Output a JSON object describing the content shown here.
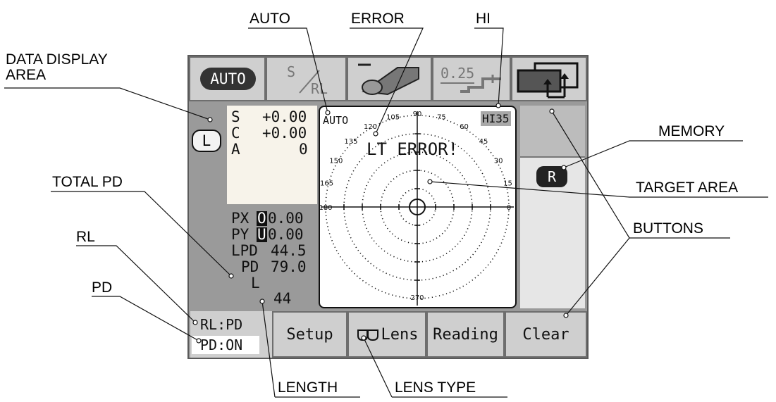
{
  "callouts": {
    "data_display_area_1": "DATA DISPLAY",
    "data_display_area_2": "AREA",
    "auto": "AUTO",
    "error": "ERROR",
    "hi": "HI",
    "memory": "MEMORY",
    "target_area": "TARGET AREA",
    "total_pd": "TOTAL PD",
    "buttons": "BUTTONS",
    "rl": "RL",
    "pd": "PD",
    "length": "LENGTH",
    "lens_type": "LENS TYPE"
  },
  "top_buttons": {
    "auto": "AUTO",
    "s": "S",
    "rl": "RL",
    "step": "0.25"
  },
  "data": {
    "s_label": "S",
    "s_value": "+0.00",
    "c_label": "C",
    "c_value": "+0.00",
    "a_label": "A",
    "a_value": "0",
    "side": "L",
    "px_label": "PX",
    "px_prefix": "O",
    "px_value": "0.00",
    "py_label": "PY",
    "py_prefix": "U",
    "py_value": "0.00",
    "lpd_label": "LPD",
    "lpd_value": "44.5",
    "pd_label": "PD",
    "pd_value": "79.0",
    "length_label": "L",
    "length_value": "44"
  },
  "target": {
    "auto": "AUTO",
    "hi": "HI35",
    "error": "LT ERROR!",
    "angles": [
      "90",
      "105",
      "75",
      "120",
      "60",
      "135",
      "45",
      "150",
      "30",
      "165",
      "15",
      "180",
      "0",
      "270"
    ]
  },
  "memory_label": "R",
  "bottom_buttons": {
    "rl_pd": "RL:PD",
    "pd_on": "PD:ON",
    "setup": "Setup",
    "lens": "Lens",
    "reading": "Reading",
    "clear": "Clear"
  },
  "colors": {
    "screen_bg": "#9a9a9a",
    "button_bg": "#cfcfcf",
    "data_bg": "#f7f3ea",
    "badge": "#333333"
  }
}
